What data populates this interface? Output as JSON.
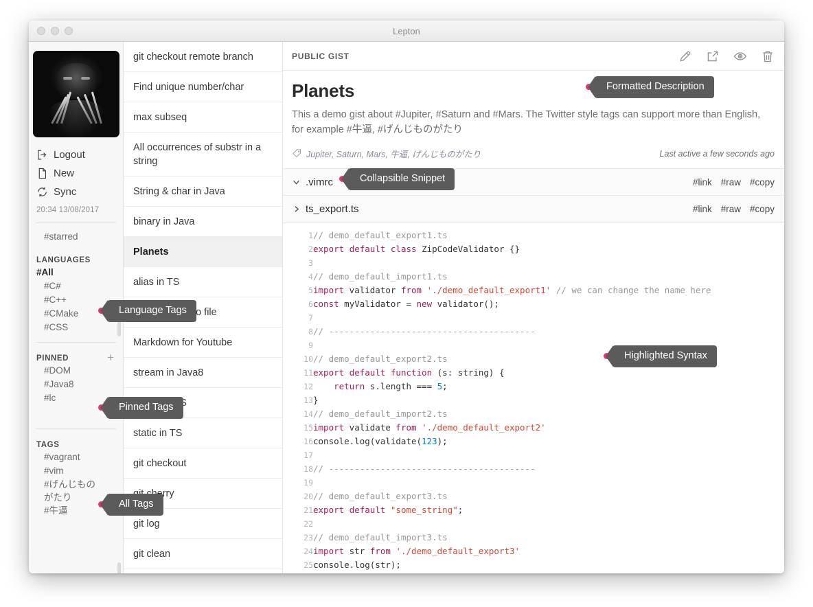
{
  "window": {
    "title": "Lepton",
    "traffic_lights": [
      "close",
      "minimize",
      "zoom"
    ]
  },
  "sidebar": {
    "avatar_alt": "user-avatar",
    "actions": [
      {
        "icon": "logout-icon",
        "label": "Logout"
      },
      {
        "icon": "new-file-icon",
        "label": "New"
      },
      {
        "icon": "sync-icon",
        "label": "Sync"
      }
    ],
    "sync_time": "20:34 13/08/2017",
    "starred_label": "#starred",
    "sections": [
      {
        "title": "LANGUAGES",
        "has_add": false,
        "items": [
          {
            "label": "#All",
            "active": true
          },
          {
            "label": "#C#",
            "active": false
          },
          {
            "label": "#C++",
            "active": false
          },
          {
            "label": "#CMake",
            "active": false
          },
          {
            "label": "#CSS",
            "active": false
          }
        ]
      },
      {
        "title": "PINNED",
        "has_add": true,
        "add_label": "+",
        "items": [
          {
            "label": "#DOM",
            "active": false
          },
          {
            "label": "#Java8",
            "active": false
          },
          {
            "label": "#lc",
            "active": false
          }
        ]
      },
      {
        "title": "TAGS",
        "has_add": false,
        "items": [
          {
            "label": "#vagrant",
            "active": false
          },
          {
            "label": "#vim",
            "active": false
          },
          {
            "label": "#げんじものがたり",
            "active": false
          },
          {
            "label": "#牛逼",
            "active": false
          }
        ]
      }
    ]
  },
  "gist_list": [
    {
      "label": "git checkout remote branch",
      "selected": false,
      "tall": false
    },
    {
      "label": "Find unique number/char",
      "selected": false,
      "tall": false
    },
    {
      "label": "max subseq",
      "selected": false,
      "tall": false
    },
    {
      "label": "All occurrences of substr in a string",
      "selected": false,
      "tall": true
    },
    {
      "label": "String & char in Java",
      "selected": false,
      "tall": false
    },
    {
      "label": "binary in Java",
      "selected": false,
      "tall": false
    },
    {
      "label": "Planets",
      "selected": true,
      "tall": false
    },
    {
      "label": "alias in TS",
      "selected": false,
      "tall": false
    },
    {
      "label": "Dump output to file",
      "selected": false,
      "tall": false
    },
    {
      "label": "Markdown for Youtube",
      "selected": false,
      "tall": false
    },
    {
      "label": "stream in Java8",
      "selected": false,
      "tall": false
    },
    {
      "label": "export in TS",
      "selected": false,
      "tall": false
    },
    {
      "label": "static in TS",
      "selected": false,
      "tall": false
    },
    {
      "label": "git checkout",
      "selected": false,
      "tall": false
    },
    {
      "label": "git cherry",
      "selected": false,
      "tall": false
    },
    {
      "label": "git log",
      "selected": false,
      "tall": false
    },
    {
      "label": "git clean",
      "selected": false,
      "tall": false
    }
  ],
  "main": {
    "visibility": "PUBLIC GIST",
    "toolbar_icons": [
      "edit-icon",
      "external-link-icon",
      "eye-icon",
      "trash-icon"
    ],
    "title": "Planets",
    "description": "This a demo gist about #Jupiter, #Saturn and #Mars. The Twitter style tags can support more than English, for example #牛逼,  #げんじものがたり",
    "tags_line": "Jupiter, Saturn, Mars, 牛逼, げんじものがたり",
    "last_active": "Last active a few seconds ago",
    "snippets": [
      {
        "name": ".vimrc",
        "expanded": true,
        "chevron": "chevron-down-icon",
        "actions": [
          "#link",
          "#raw",
          "#copy"
        ]
      },
      {
        "name": "ts_export.ts",
        "expanded": false,
        "chevron": "chevron-right-icon",
        "actions": [
          "#link",
          "#raw",
          "#copy"
        ]
      }
    ],
    "code": {
      "language": "typescript",
      "first_line": 1,
      "last_line": 25,
      "lines": [
        "// demo_default_export1.ts",
        "export default class ZipCodeValidator {}",
        "",
        "// demo_default_import1.ts",
        "import validator from './demo_default_export1' // we can change the name here",
        "const myValidator = new validator();",
        "",
        "// ----------------------------------------",
        "",
        "// demo_default_export2.ts",
        "export default function (s: string) {",
        "    return s.length === 5;",
        "}",
        "// demo_default_import2.ts",
        "import validate from './demo_default_export2'",
        "console.log(validate(123);",
        "",
        "// ----------------------------------------",
        "",
        "// demo_default_export3.ts",
        "export default \"some_string\";",
        "",
        "// demo_default_import3.ts",
        "import str from './demo_default_export3'",
        "console.log(str);"
      ]
    }
  },
  "annotations": [
    {
      "label": "Formatted Description",
      "target": "gist-description"
    },
    {
      "label": "Collapsible Snippet",
      "target": "snippet-header"
    },
    {
      "label": "Highlighted Syntax",
      "target": "code-block"
    },
    {
      "label": "Language Tags",
      "target": "sidebar-languages"
    },
    {
      "label": "Pinned Tags",
      "target": "sidebar-pinned"
    },
    {
      "label": "All Tags",
      "target": "sidebar-tags"
    }
  ],
  "colors": {
    "accent_dot": "#f2306b",
    "callout_bg": "#5b5b5b",
    "selected_row": "#f0f0f0",
    "keyword": "#a71d5d",
    "string": "#d14836",
    "comment": "#999999"
  }
}
